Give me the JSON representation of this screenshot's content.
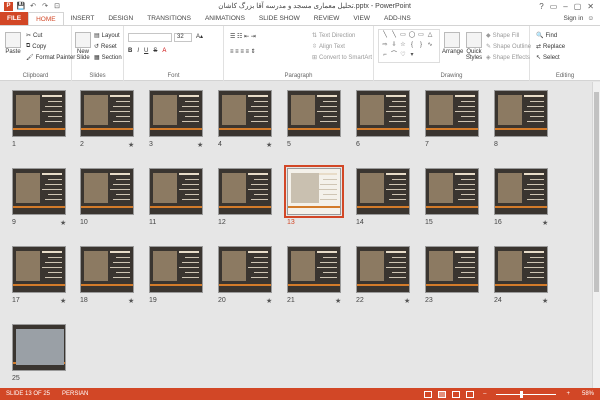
{
  "window": {
    "title": "تحلیل معماری مسجد و مدرسه آقا بزرگ کاشان.pptx - PowerPoint",
    "controls": [
      "?",
      "▭",
      "–",
      "▢",
      "✕"
    ]
  },
  "qat": {
    "logo": "P",
    "save": "💾",
    "undo": "↶",
    "redo": "↷",
    "start": "⊡"
  },
  "tabs": [
    "FILE",
    "HOME",
    "INSERT",
    "DESIGN",
    "TRANSITIONS",
    "ANIMATIONS",
    "SLIDE SHOW",
    "REVIEW",
    "VIEW",
    "ADD-INS"
  ],
  "active_tab": "HOME",
  "signin": "Sign in",
  "ribbon": {
    "clipboard": {
      "label": "Clipboard",
      "paste": "Paste",
      "cut": "Cut",
      "copy": "Copy",
      "format_painter": "Format Painter"
    },
    "slides": {
      "label": "Slides",
      "new_slide": "New Slide",
      "layout": "Layout",
      "reset": "Reset",
      "section": "Section"
    },
    "font": {
      "label": "Font",
      "size": "32",
      "bold": "B",
      "italic": "I",
      "underline": "U",
      "strike": "S",
      "aa": "A"
    },
    "paragraph": {
      "label": "Paragraph",
      "text_direction": "Text Direction",
      "align_text": "Align Text",
      "convert_smartart": "Convert to SmartArt"
    },
    "drawing": {
      "label": "Drawing",
      "arrange": "Arrange",
      "quick_styles": "Quick Styles",
      "shape_fill": "Shape Fill",
      "shape_outline": "Shape Outline",
      "shape_effects": "Shape Effects"
    },
    "editing": {
      "label": "Editing",
      "find": "Find",
      "replace": "Replace",
      "select": "Select"
    }
  },
  "slides": [
    {
      "num": "1",
      "star": ""
    },
    {
      "num": "2",
      "star": "★"
    },
    {
      "num": "3",
      "star": "★"
    },
    {
      "num": "4",
      "star": "★"
    },
    {
      "num": "5",
      "star": ""
    },
    {
      "num": "6",
      "star": ""
    },
    {
      "num": "7",
      "star": ""
    },
    {
      "num": "8",
      "star": ""
    },
    {
      "num": "9",
      "star": "★"
    },
    {
      "num": "10",
      "star": ""
    },
    {
      "num": "11",
      "star": ""
    },
    {
      "num": "12",
      "star": ""
    },
    {
      "num": "13",
      "star": ""
    },
    {
      "num": "14",
      "star": ""
    },
    {
      "num": "15",
      "star": ""
    },
    {
      "num": "16",
      "star": "★"
    },
    {
      "num": "17",
      "star": "★"
    },
    {
      "num": "18",
      "star": "★"
    },
    {
      "num": "19",
      "star": ""
    },
    {
      "num": "20",
      "star": "★"
    },
    {
      "num": "21",
      "star": "★"
    },
    {
      "num": "22",
      "star": "★"
    },
    {
      "num": "23",
      "star": ""
    },
    {
      "num": "24",
      "star": "★"
    },
    {
      "num": "25",
      "star": ""
    }
  ],
  "selected_slide": "13",
  "status": {
    "slide_info": "SLIDE 13 OF 25",
    "language": "PERSIAN",
    "zoom": "58%",
    "zoom_level": 0.58
  },
  "colors": {
    "accent": "#d24726",
    "slide_bg": "#3a3530",
    "slide_bar": "#d37b2a"
  }
}
